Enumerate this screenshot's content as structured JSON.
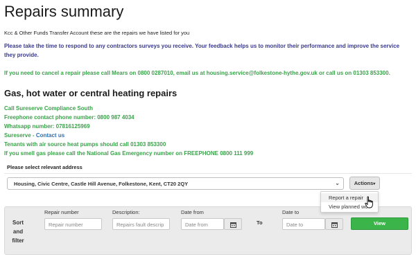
{
  "page": {
    "title": "Repairs summary",
    "account_line": "Kcc & Other Funds Transfer Account these are the repairs we have listed for you",
    "feedback_notice": "Please take the time to respond to any contractors surveys you receive. Your feedback helps us to monitor their performance and improve the service they provide.",
    "cancel_notice": "If you need to cancel a repair please call Mears on 0800 0287010, email us at housing.service@folkestone-hythe.gov.uk or call us on 01303 853300."
  },
  "gas_section": {
    "heading": "Gas, hot water or central heating repairs",
    "lines": {
      "call": "Call Sureserve Compliance South",
      "freephone": "Freephone contact phone number: 0800 987 4034",
      "whatsapp": "Whatsapp number: 07816125969",
      "sureserve_prefix": "Sureserve - ",
      "contact_link": "Contact us",
      "heat_pumps": "Tenants with air source heat pumps should call 01303 853300",
      "smell_gas": "If you smell gas please call the National Gas Emergency number on FREEPHONE 0800 111 999"
    }
  },
  "address": {
    "label": "Please select relevant address",
    "selected": "Housing, Civic Centre, Castle Hill Avenue, Folkestone, Kent, CT20 2QY"
  },
  "actions": {
    "label": "Actions",
    "menu": {
      "report": "Report a repair",
      "view_planned": "View planned wo"
    }
  },
  "filter": {
    "sort_label": "Sort and filter",
    "repair_number_label": "Repair number",
    "repair_number_placeholder": "Repair number",
    "description_label": "Description:",
    "description_placeholder": "Repairs fault descrip",
    "date_from_label": "Date from",
    "date_from_placeholder": "Date from",
    "to_label": "To",
    "date_to_label": "Date to",
    "date_to_placeholder": "Date to",
    "view_button": "View"
  },
  "colors": {
    "green_text": "#3aa24a",
    "blue_text": "#3a3a8c",
    "link": "#2c6fb3",
    "view_button": "#3bb54a"
  }
}
